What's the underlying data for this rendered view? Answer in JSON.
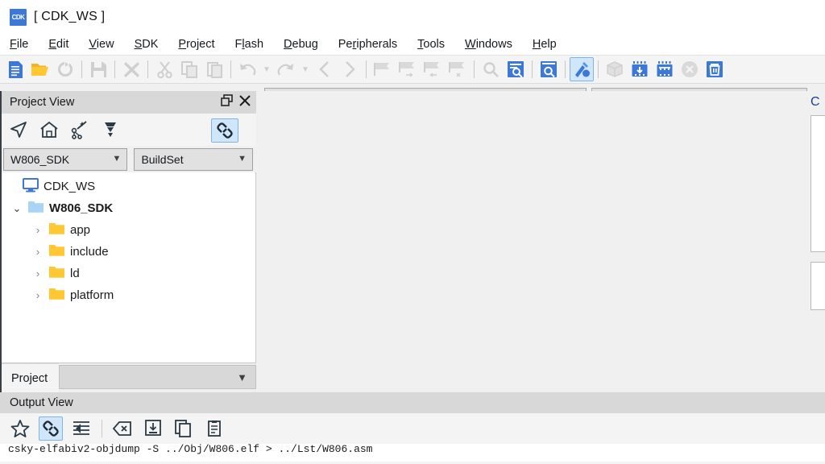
{
  "window": {
    "title": "[ CDK_WS ]",
    "logo_text": "CDK",
    "logo_color": "#3b78d8"
  },
  "menubar": {
    "items": [
      {
        "mnemonic": "F",
        "rest": "ile"
      },
      {
        "mnemonic": "E",
        "rest": "dit"
      },
      {
        "mnemonic": "V",
        "rest": "iew"
      },
      {
        "mnemonic": "S",
        "rest": "DK"
      },
      {
        "mnemonic": "P",
        "rest": "roject"
      },
      {
        "mnemonic": "Fl",
        "rest": "ash"
      },
      {
        "mnemonic": "D",
        "rest": "ebug"
      },
      {
        "mnemonic": "Pe",
        "rest": "ripherals"
      },
      {
        "mnemonic": "T",
        "rest": "ools"
      },
      {
        "mnemonic": "W",
        "rest": "indows"
      },
      {
        "mnemonic": "H",
        "rest": "elp"
      }
    ],
    "labels": [
      "File",
      "Edit",
      "View",
      "SDK",
      "Project",
      "Flash",
      "Debug",
      "Peripherals",
      "Tools",
      "Windows",
      "Help"
    ]
  },
  "toolbar": {
    "buttons": [
      {
        "name": "new-file-icon",
        "state": "enabled"
      },
      {
        "name": "open-folder-icon",
        "state": "enabled"
      },
      {
        "name": "refresh-icon",
        "state": "disabled"
      },
      {
        "name": "save-icon",
        "state": "disabled"
      },
      {
        "name": "delete-icon",
        "state": "disabled"
      },
      {
        "name": "cut-icon",
        "state": "disabled"
      },
      {
        "name": "copy-icon",
        "state": "disabled"
      },
      {
        "name": "paste-icon",
        "state": "disabled"
      },
      {
        "name": "undo-icon",
        "state": "disabled"
      },
      {
        "name": "redo-icon",
        "state": "disabled"
      },
      {
        "name": "navigate-back-icon",
        "state": "disabled"
      },
      {
        "name": "navigate-forward-icon",
        "state": "disabled"
      },
      {
        "name": "bookmark-toggle-icon",
        "state": "disabled"
      },
      {
        "name": "bookmark-next-icon",
        "state": "disabled"
      },
      {
        "name": "bookmark-prev-icon",
        "state": "disabled"
      },
      {
        "name": "bookmark-clear-icon",
        "state": "disabled"
      },
      {
        "name": "find-icon",
        "state": "disabled"
      },
      {
        "name": "find-in-files-icon",
        "state": "enabled"
      },
      {
        "name": "search-document-icon",
        "state": "enabled"
      },
      {
        "name": "build-icon",
        "state": "active"
      },
      {
        "name": "package-icon",
        "state": "disabled"
      },
      {
        "name": "download-icon",
        "state": "enabled"
      },
      {
        "name": "flash-download-icon",
        "state": "enabled"
      },
      {
        "name": "stop-icon",
        "state": "disabled"
      },
      {
        "name": "clean-icon",
        "state": "enabled"
      }
    ],
    "combo_left_value": "",
    "combo_right_value": ""
  },
  "project_view": {
    "title": "Project View",
    "float_icon": "restore-icon",
    "close_icon": "close-icon",
    "tool_icons": [
      "navigate-icon",
      "home-icon",
      "magic-wand-icon",
      "collapse-all-icon"
    ],
    "link_toggle_icon": "link-editor-icon",
    "combo_sdk": "W806_SDK",
    "combo_buildset": "BuildSet",
    "tree": [
      {
        "label": "CDK_WS",
        "level": 0,
        "icon": "workspace-icon",
        "twisty": "",
        "bold": false
      },
      {
        "label": "W806_SDK",
        "level": 1,
        "icon": "folder-blue-icon",
        "twisty": "expanded",
        "bold": true
      },
      {
        "label": "app",
        "level": 2,
        "icon": "folder-yellow-icon",
        "twisty": "collapsed",
        "bold": false
      },
      {
        "label": "include",
        "level": 2,
        "icon": "folder-yellow-icon",
        "twisty": "collapsed",
        "bold": false
      },
      {
        "label": "ld",
        "level": 2,
        "icon": "folder-yellow-icon",
        "twisty": "collapsed",
        "bold": false
      },
      {
        "label": "platform",
        "level": 2,
        "icon": "folder-yellow-icon",
        "twisty": "collapsed",
        "bold": false
      }
    ],
    "bottom_tab": "Project",
    "bottom_combo_value": ""
  },
  "editor": {
    "label": "C"
  },
  "output_view": {
    "title": "Output View",
    "tool_icons": [
      "favorite-star-icon",
      "link-icon",
      "word-wrap-icon",
      "clear-icon",
      "save-output-icon",
      "copy-icon",
      "paste-icon"
    ],
    "line": "csky-elfabiv2-objdump -S ../Obj/W806.elf > ../Lst/W806.asm"
  },
  "colors": {
    "accent_blue": "#3b78d8",
    "folder_yellow": "#ffc832",
    "folder_blue": "#a8d4f5",
    "active_highlight": "#cfe6fb",
    "panel_header": "#d8d8d8",
    "toolbar_bg": "#f4f4f4"
  }
}
